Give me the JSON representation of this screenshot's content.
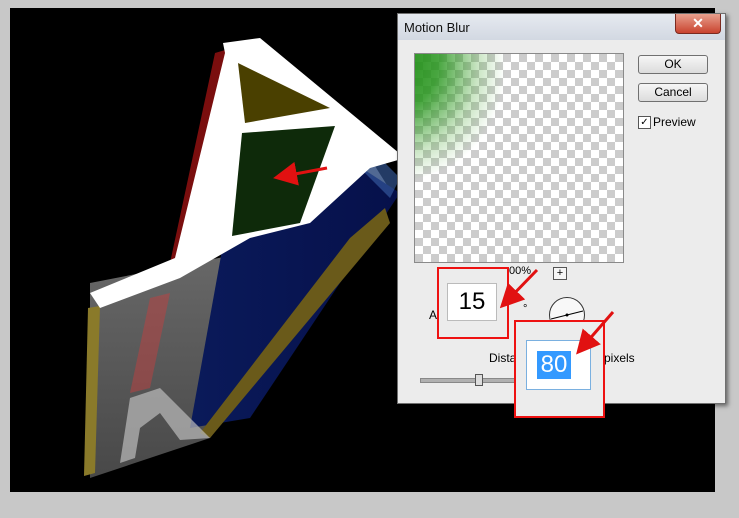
{
  "dialog": {
    "title": "Motion Blur",
    "close_glyph": "✕",
    "ok_label": "OK",
    "cancel_label": "Cancel",
    "preview_label": "Preview",
    "preview_checked": "✓",
    "zoom_percent": "00%",
    "zoom_plus": "+",
    "angle_label_partial": "A",
    "degree_symbol": "°",
    "distance_label_partial": "Dista",
    "distance_unit": "pixels"
  },
  "callouts": {
    "angle_value": "15",
    "distance_value": "80"
  },
  "colors": {
    "canvas_bg": "#000000",
    "callout_red": "#e11111",
    "selection_blue": "#3399ff"
  }
}
